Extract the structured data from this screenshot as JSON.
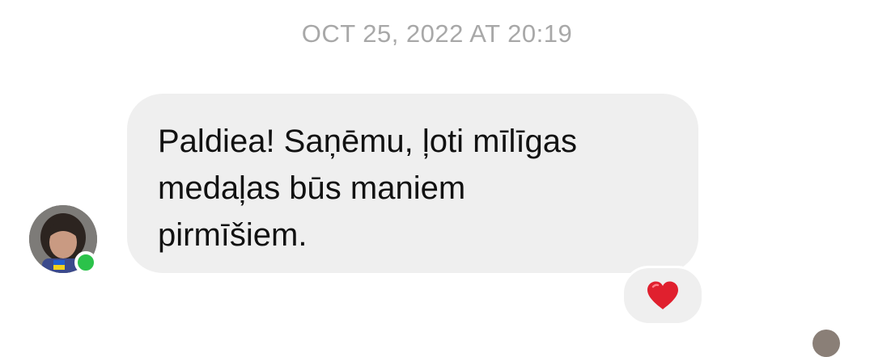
{
  "thread": {
    "timestamp": "OCT 25, 2022 AT 20:19"
  },
  "message": {
    "text": "Paldiea! Saņēmu, ļoti mīlīgas\nmedaļas būs maniem\npirmīšiem.",
    "sender_status": "online"
  },
  "reaction": {
    "icon": "heart-icon",
    "color": "#e0202e"
  },
  "colors": {
    "bubble": "#efefef",
    "timestamp": "#a8a8a8",
    "online": "#2bc24a"
  }
}
